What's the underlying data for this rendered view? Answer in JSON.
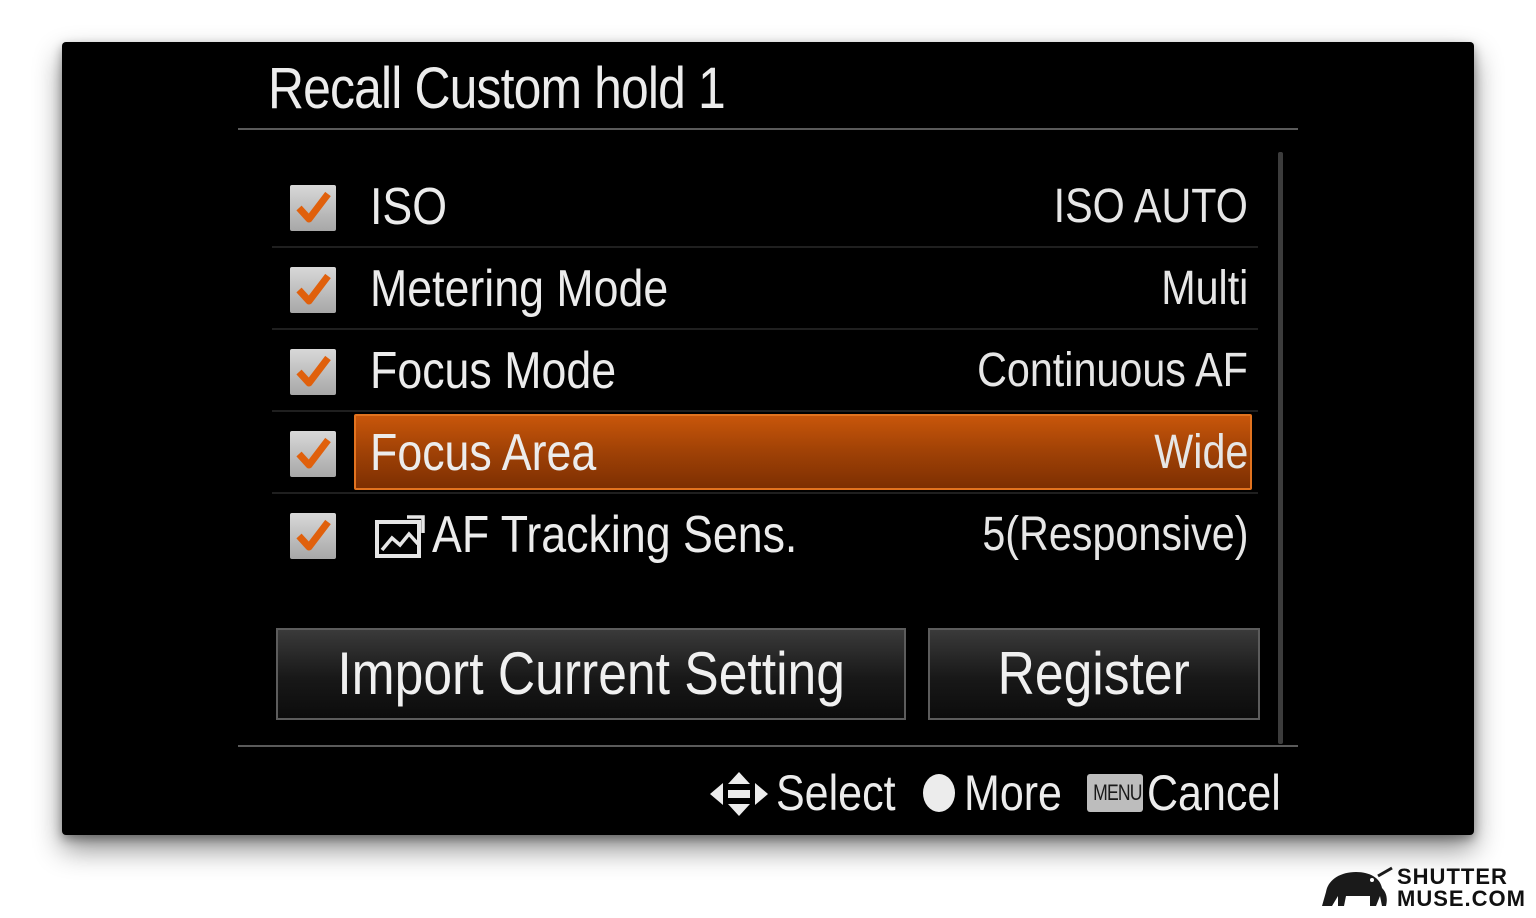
{
  "screen": {
    "title": "Recall Custom hold 1"
  },
  "settings": [
    {
      "label": "ISO",
      "value": "ISO AUTO",
      "checked": true
    },
    {
      "label": "Metering Mode",
      "value": "Multi",
      "checked": true
    },
    {
      "label": "Focus Mode",
      "value": "Continuous AF",
      "checked": true
    },
    {
      "label": "Focus Area",
      "value": "Wide",
      "checked": true,
      "selected": true
    },
    {
      "label": "AF Tracking Sens.",
      "value": "5(Responsive)",
      "checked": true,
      "icon": "still-image-mode-icon"
    }
  ],
  "buttons": {
    "import": "Import Current Setting",
    "register": "Register"
  },
  "hints": {
    "select": "Select",
    "more": "More",
    "menu_key": "MENU",
    "cancel": "Cancel"
  },
  "watermark": {
    "line1": "SHUTTER",
    "line2": "MUSE.COM",
    "icon": "elephant-logo"
  },
  "colors": {
    "highlight": "#a14206",
    "check": "#e0600c",
    "background": "#000000"
  }
}
